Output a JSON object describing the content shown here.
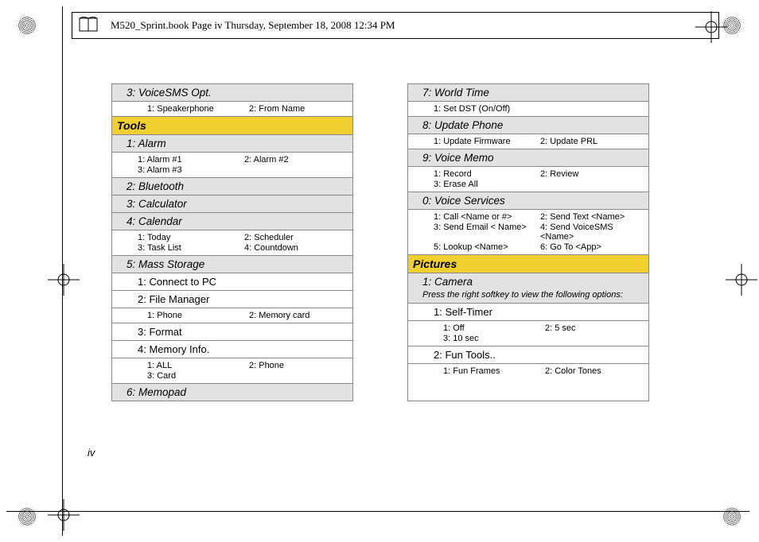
{
  "header": {
    "text": "M520_Sprint.book  Page iv  Thursday, September 18, 2008  12:34 PM"
  },
  "pagenum": "iv",
  "left": {
    "voicesms": {
      "label": "3: VoiceSMS Opt.",
      "o1": "1: Speakerphone",
      "o2": "2: From Name"
    },
    "tools": {
      "head": "Tools",
      "alarm": {
        "label": "1: Alarm",
        "o1": "1: Alarm #1",
        "o2": "2: Alarm #2",
        "o3": "3: Alarm #3"
      },
      "bluetooth": {
        "label": "2: Bluetooth"
      },
      "calc": {
        "label": "3: Calculator"
      },
      "calendar": {
        "label": "4: Calendar",
        "o1": "1: Today",
        "o2": "2: Scheduler",
        "o3": "3: Task List",
        "o4": "4: Countdown"
      },
      "mass": {
        "label": "5: Mass Storage",
        "connect": {
          "label": "1: Connect to PC"
        },
        "fm": {
          "label": "2: File Manager",
          "o1": "1: Phone",
          "o2": "2: Memory card"
        },
        "format": {
          "label": "3: Format"
        },
        "mem": {
          "label": "4: Memory Info.",
          "o1": "1: ALL",
          "o2": "2: Phone",
          "o3": "3: Card"
        }
      },
      "memopad": {
        "label": "6: Memopad"
      }
    }
  },
  "right": {
    "world": {
      "label": "7: World Time",
      "o1": "1: Set DST (On/Off)"
    },
    "update": {
      "label": "8: Update Phone",
      "o1": "1: Update Firmware",
      "o2": "2: Update PRL"
    },
    "memo": {
      "label": "9: Voice Memo",
      "o1": "1: Record",
      "o2": "2: Review",
      "o3": "3: Erase All"
    },
    "vs": {
      "label": "0: Voice Services",
      "o1": "1: Call <Name or #>",
      "o2": "2: Send Text <Name>",
      "o3": "3: Send Email < Name>",
      "o4": "4: Send VoiceSMS <Name>",
      "o5": "5: Lookup <Name>",
      "o6": "6: Go To <App>"
    },
    "pictures": {
      "head": "Pictures",
      "camera": {
        "label": "1: Camera",
        "note": "Press the right softkey to view the following options:",
        "self": {
          "label": "1: Self-Timer",
          "o1": "1: Off",
          "o2": "2: 5 sec",
          "o3": "3: 10 sec"
        },
        "fun": {
          "label": "2: Fun Tools..",
          "o1": "1: Fun Frames",
          "o2": "2: Color Tones"
        }
      }
    }
  }
}
